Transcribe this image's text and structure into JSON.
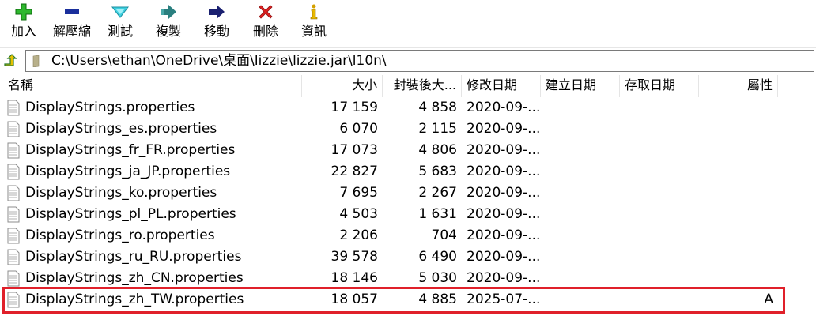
{
  "toolbar": {
    "buttons": [
      {
        "label": "加入",
        "icon": "plus-icon",
        "color": "#2eb82e"
      },
      {
        "label": "解壓縮",
        "icon": "minus-icon",
        "color": "#1a2f9c"
      },
      {
        "label": "測試",
        "icon": "check-icon",
        "color": "#2bb3c9"
      },
      {
        "label": "複製",
        "icon": "copy-arrow-icon",
        "color": "#2a7f7f"
      },
      {
        "label": "移動",
        "icon": "move-arrow-icon",
        "color": "#1a2070"
      },
      {
        "label": "刪除",
        "icon": "delete-x-icon",
        "color": "#e02020"
      },
      {
        "label": "資訊",
        "icon": "info-icon",
        "color": "#d4a000"
      }
    ]
  },
  "address": {
    "path": "C:\\Users\\ethan\\OneDrive\\桌面\\lizzie\\lizzie.jar\\l10n\\"
  },
  "columns": {
    "name": "名稱",
    "size": "大小",
    "packed": "封裝後大...",
    "modified": "修改日期",
    "created": "建立日期",
    "accessed": "存取日期",
    "attributes": "屬性"
  },
  "files": [
    {
      "name": "DisplayStrings.properties",
      "size": "17 159",
      "packed": "4 858",
      "modified": "2020-09-...",
      "attr": ""
    },
    {
      "name": "DisplayStrings_es.properties",
      "size": "6 070",
      "packed": "2 115",
      "modified": "2020-09-...",
      "attr": ""
    },
    {
      "name": "DisplayStrings_fr_FR.properties",
      "size": "17 073",
      "packed": "4 806",
      "modified": "2020-09-...",
      "attr": ""
    },
    {
      "name": "DisplayStrings_ja_JP.properties",
      "size": "22 827",
      "packed": "5 683",
      "modified": "2020-09-...",
      "attr": ""
    },
    {
      "name": "DisplayStrings_ko.properties",
      "size": "7 695",
      "packed": "2 267",
      "modified": "2020-09-...",
      "attr": ""
    },
    {
      "name": "DisplayStrings_pl_PL.properties",
      "size": "4 503",
      "packed": "1 631",
      "modified": "2020-09-...",
      "attr": ""
    },
    {
      "name": "DisplayStrings_ro.properties",
      "size": "2 206",
      "packed": "704",
      "modified": "2020-09-...",
      "attr": ""
    },
    {
      "name": "DisplayStrings_ru_RU.properties",
      "size": "39 578",
      "packed": "6 490",
      "modified": "2020-09-...",
      "attr": ""
    },
    {
      "name": "DisplayStrings_zh_CN.properties",
      "size": "18 146",
      "packed": "5 030",
      "modified": "2020-09-...",
      "attr": ""
    },
    {
      "name": "DisplayStrings_zh_TW.properties",
      "size": "18 057",
      "packed": "4 885",
      "modified": "2025-07-...",
      "attr": "A"
    }
  ],
  "highlight_color": "#e0202a"
}
